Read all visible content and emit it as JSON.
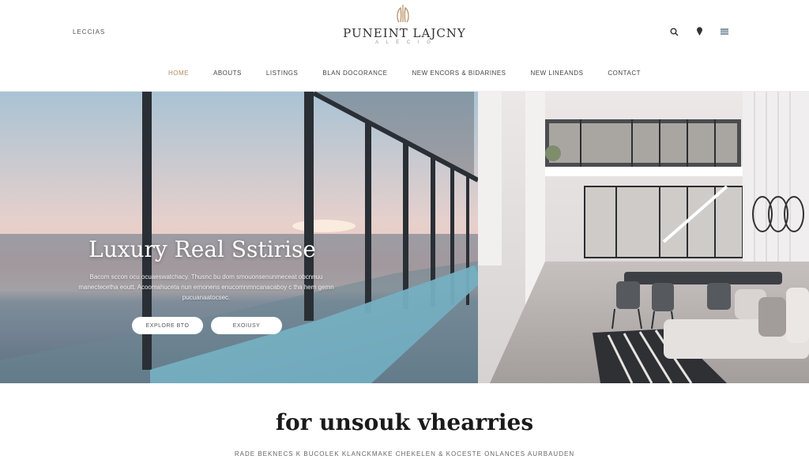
{
  "header": {
    "left_link": "LECCIAS",
    "brand": "PUNEINT  LAJCNY",
    "brand_sub": "A L E C I G",
    "icons": [
      "search-icon",
      "pin-icon",
      "menu-icon"
    ]
  },
  "nav": {
    "items": [
      {
        "label": "HOME",
        "active": true
      },
      {
        "label": "ABOUTS"
      },
      {
        "label": "LISTINGS"
      },
      {
        "label": "BLAN DOCORANCE"
      },
      {
        "label": "NEW ENCORS & BIDARINES"
      },
      {
        "label": "NEW LINEANDS"
      },
      {
        "label": "CONTACT"
      }
    ]
  },
  "hero": {
    "title": "Luxury Real Sstirise",
    "description": "Bacom sccon ocu ocuaeswatchacy. Thusnc bu dom smouonsenunmeceat obcnnuu manectecetha eoutt. Acoomahuceta nun ernonens enucomnmncanacaboy c tha hem gemn pucuanaatocsec.",
    "button_primary": "EXPLORE BTO",
    "button_secondary": "EXOIUSY"
  },
  "section": {
    "title": "for unsouk vhearries",
    "subtitle": "RADE BEKNECS K BUCOLEK KLANCKMAKE CHEKELEN & KOCESTE ONLANCES AURBAUDEN"
  }
}
